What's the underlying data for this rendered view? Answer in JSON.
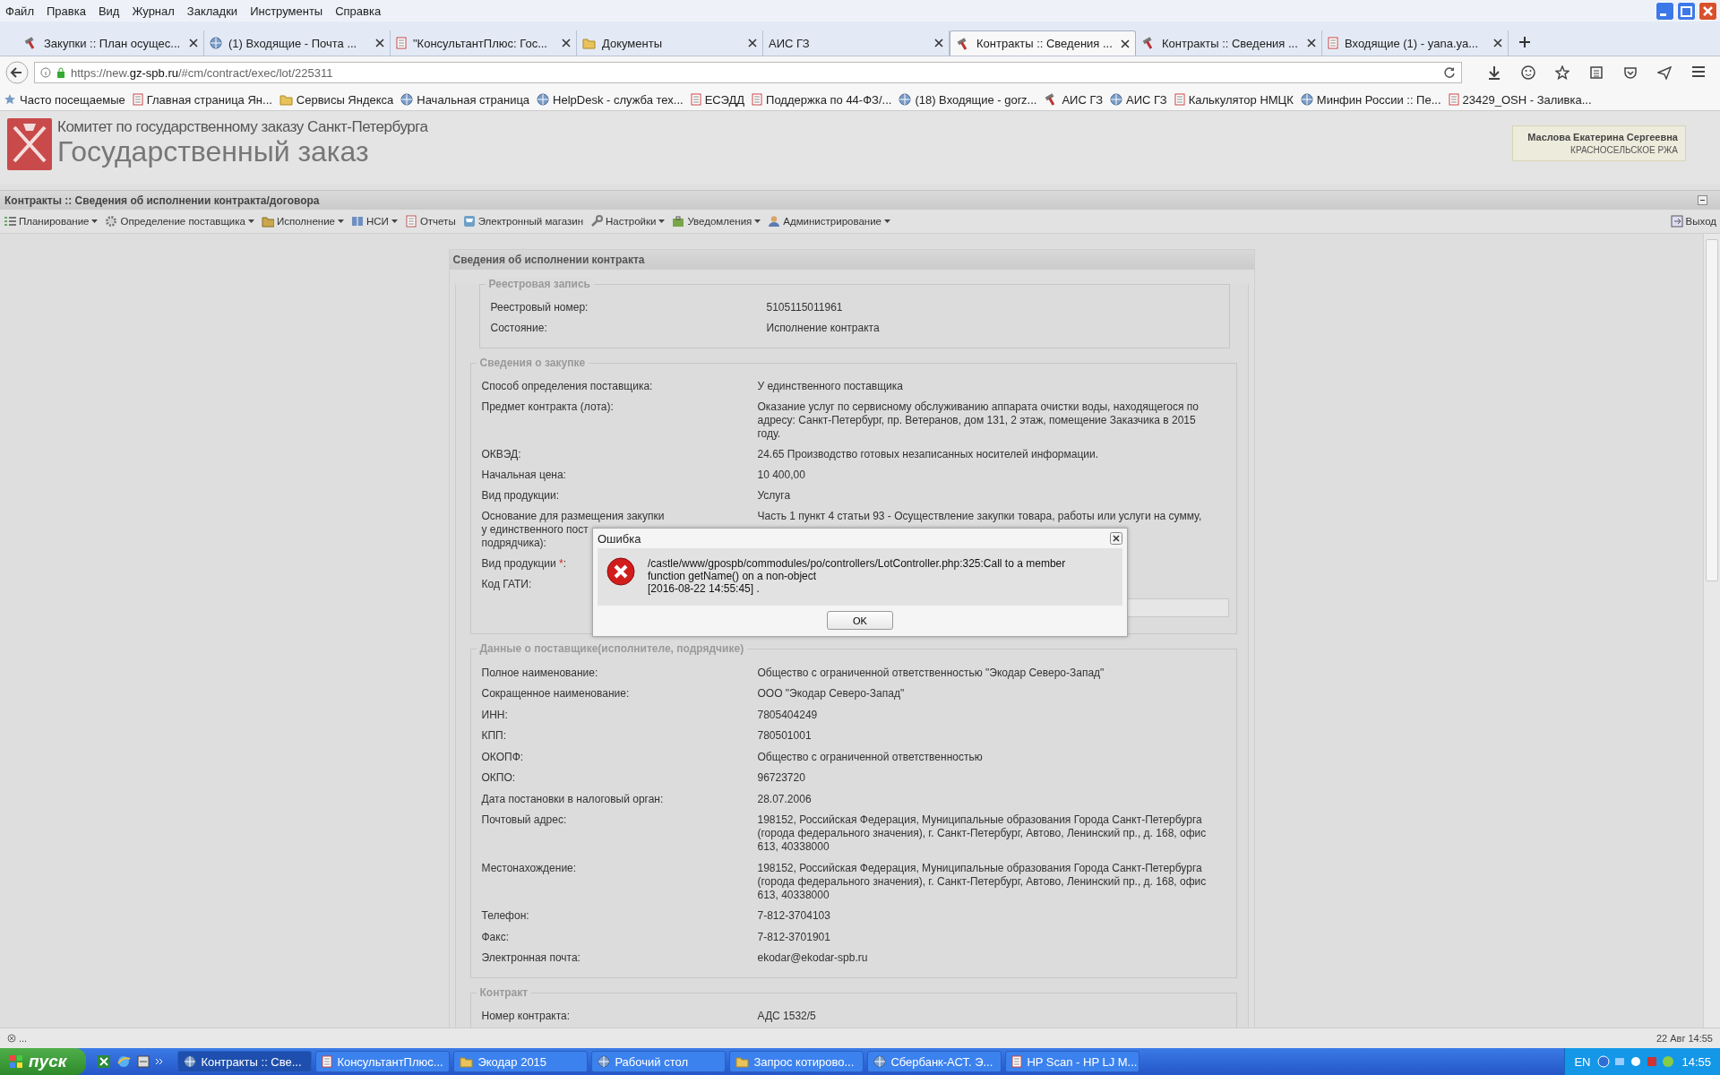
{
  "menu_bar": [
    "Файл",
    "Правка",
    "Вид",
    "Журнал",
    "Закладки",
    "Инструменты",
    "Справка"
  ],
  "tabs": [
    {
      "title": "Закупки :: План осущес...",
      "selected": false
    },
    {
      "title": "(1) Входящие - Почта ...",
      "selected": false
    },
    {
      "title": "\"КонсультантПлюс: Гос...",
      "selected": false
    },
    {
      "title": "Документы",
      "selected": false
    },
    {
      "title": "АИС ГЗ",
      "selected": false
    },
    {
      "title": "Контракты :: Сведения ...",
      "selected": true
    },
    {
      "title": "Контракты :: Сведения ...",
      "selected": false
    },
    {
      "title": "Входящие (1) - yana.ya...",
      "selected": false
    }
  ],
  "address_bar": {
    "url": "https://new.**gz-spb.ru**/#cm/contract/exec/lot/225311"
  },
  "bookmarks": [
    "Часто посещаемые",
    "Главная страница Ян...",
    "Сервисы Яндекса",
    "Начальная страница",
    "HelpDesk - служба тех...",
    "ЕСЭДД",
    "Поддержка по 44-ФЗ/...",
    "(18) Входящие - gorz...",
    "АИС ГЗ",
    "АИС ГЗ",
    "Калькулятор НМЦК",
    "Минфин России :: Пе...",
    "23429_OSH - Заливка..."
  ],
  "header": {
    "org": "Комитет по государственному заказу Санкт-Петербурга",
    "title": "Государственный заказ",
    "user": {
      "name": "Маслова Екатерина Сергеевна",
      "unit": "КРАСНОСЕЛЬСКОЕ РЖА"
    }
  },
  "page_title": "Контракты :: Сведения об исполнении контракта/договора",
  "toolbar": [
    {
      "label": "Планирование",
      "dropdown": true
    },
    {
      "label": "Определение поставщика",
      "dropdown": true
    },
    {
      "label": "Исполнение",
      "dropdown": true
    },
    {
      "label": "НСИ",
      "dropdown": true
    },
    {
      "label": "Отчеты",
      "dropdown": false
    },
    {
      "label": "Электронный магазин",
      "dropdown": false
    },
    {
      "label": "Настройки",
      "dropdown": true
    },
    {
      "label": "Уведомления",
      "dropdown": true
    },
    {
      "label": "Администрирование",
      "dropdown": true
    }
  ],
  "exit_button": "Выход",
  "panel": {
    "title": "Сведения об исполнении контракта",
    "sections": [
      {
        "legend": "Реестровая запись",
        "rows": [
          {
            "kind": "text",
            "label": "Реестровый номер:",
            "value": "5105115011961"
          },
          {
            "kind": "text",
            "label": "Состояние:",
            "value": "Исполнение контракта"
          }
        ]
      },
      {
        "legend": "Сведения о закупке",
        "rows": [
          {
            "kind": "text",
            "label": "Способ определения поставщика:",
            "value": "У единственного поставщика"
          },
          {
            "kind": "text",
            "label": "Предмет контракта (лота):",
            "value": "Оказание услуг по сервисному обслуживанию аппарата очистки воды, находящегося по адресу: Санкт-Петербург, пр. Ветеранов, дом 131, 2 этаж, помещение Заказчика в 2015 году."
          },
          {
            "kind": "text",
            "label": "ОКВЭД:",
            "value": "24.65 Производство готовых незаписанных носителей информации."
          },
          {
            "kind": "text",
            "label": "Начальная цена:",
            "value": "10 400,00"
          },
          {
            "kind": "text",
            "label": "Вид продукции:",
            "value": "Услуга"
          },
          {
            "kind": "text",
            "label_lines": [
              "Основание для размещения закупки",
              "у единственного пост",
              "подрядчика):"
            ],
            "value": "Часть 1 пункт 4 статьи 93 - Осуществление закупки товара, работы или услуги на сумму,"
          },
          {
            "kind": "text",
            "label": "Вид продукции ",
            "required_mark": "*",
            "label_end": ":"
          },
          {
            "kind": "field",
            "label": "Код ГАТИ:"
          }
        ]
      },
      {
        "legend": "Данные о поставщике(исполнителе, подрядчике)",
        "rows": [
          {
            "kind": "text",
            "label": "Полное наименование:",
            "value": "Общество с ограниченной ответственностью \"Экодар Северо-Запад\""
          },
          {
            "kind": "text",
            "label": "Сокращенное наименование:",
            "value": "ООО \"Экодар Северо-Запад\""
          },
          {
            "kind": "text",
            "label": "ИНН:",
            "value": "7805404249"
          },
          {
            "kind": "text",
            "label": "КПП:",
            "value": "780501001"
          },
          {
            "kind": "text",
            "label": "ОКОПФ:",
            "value": "Общество с ограниченной ответственностью"
          },
          {
            "kind": "text",
            "label": "ОКПО:",
            "value": "96723720"
          },
          {
            "kind": "text",
            "label": "Дата постановки в налоговый орган:",
            "value": "28.07.2006"
          },
          {
            "kind": "text",
            "label": "Почтовый адрес:",
            "value": "198152, Российская Федерация, Муниципальные образования Города Санкт-Петербурга (города федерального значения), г. Санкт-Петербург, Автово, Ленинский пр., д. 168, офис 613, 40338000"
          },
          {
            "kind": "text",
            "label": "Местонахождение:",
            "value": "198152, Российская Федерация, Муниципальные образования Города Санкт-Петербурга (города федерального значения), г. Санкт-Петербург, Автово, Ленинский пр., д. 168, офис 613, 40338000"
          },
          {
            "kind": "text",
            "label": "Телефон:",
            "value": "7-812-3704103"
          },
          {
            "kind": "text",
            "label": "Факс:",
            "value": "7-812-3701901"
          },
          {
            "kind": "text",
            "label": "Электронная почта:",
            "value": "ekodar@ekodar-spb.ru"
          }
        ]
      },
      {
        "legend": "Контракт",
        "rows": [
          {
            "kind": "text",
            "label": "Номер контракта:",
            "value": "АДС 1532/5"
          }
        ]
      }
    ]
  },
  "dialog": {
    "title": "Ошибка",
    "message_lines": [
      "/castle/www/gpospb/commodules/po/controllers/LotController.php:325:Call to a member",
      "function getName() on a non-object",
      "[2016-08-22 14:55:45] ."
    ],
    "button": "OK"
  },
  "status_bar": {
    "left": "...",
    "right": "22 Авг 14:55"
  },
  "taskbar": {
    "start": "пуск",
    "tasks": [
      {
        "label": "Контракты :: Све...",
        "selected": true
      },
      {
        "label": "КонсультантПлюс...",
        "selected": false
      },
      {
        "label": "Экодар 2015",
        "selected": false
      },
      {
        "label": "Рабочий стол",
        "selected": false
      },
      {
        "label": "Запрос котирово...",
        "selected": false
      },
      {
        "label": "Сбербанк-АСТ. Э...",
        "selected": false
      },
      {
        "label": "HP Scan - HP LJ M...",
        "selected": false
      }
    ],
    "language": "EN",
    "clock": "14:55"
  }
}
